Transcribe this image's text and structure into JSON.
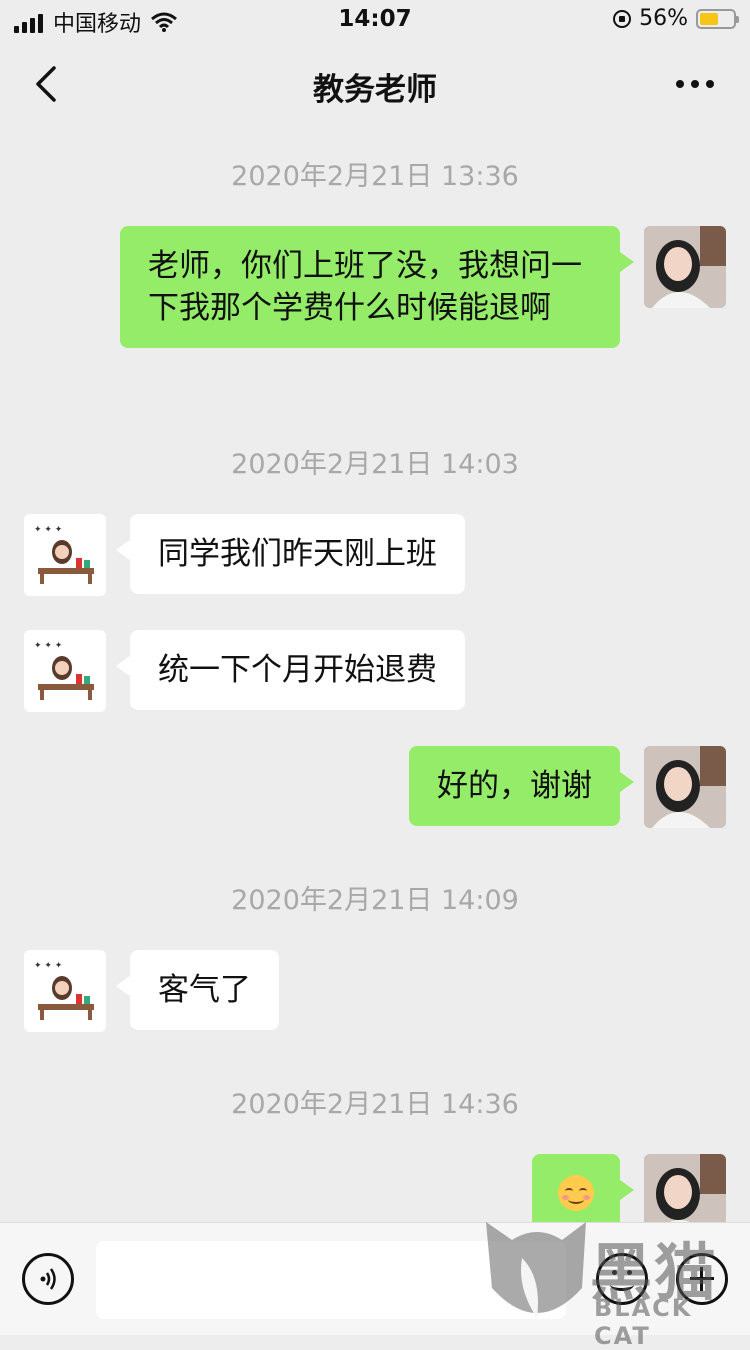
{
  "status_bar": {
    "carrier": "中国移动",
    "time": "14:07",
    "battery": "56%",
    "battery_level": 0.56
  },
  "nav": {
    "title": "教务老师"
  },
  "messages": [
    {
      "type": "timestamp",
      "text": "2020年2月21日 13:36"
    },
    {
      "type": "out",
      "text": "老师，你们上班了没，我想问一下我那个学费什么时候能退啊"
    },
    {
      "type": "timestamp",
      "text": "2020年2月21日 14:03"
    },
    {
      "type": "in",
      "text": "同学我们昨天刚上班"
    },
    {
      "type": "in",
      "text": "统一下个月开始退费"
    },
    {
      "type": "out",
      "text": "好的，谢谢"
    },
    {
      "type": "timestamp",
      "text": "2020年2月21日 14:09"
    },
    {
      "type": "in",
      "text": "客气了"
    },
    {
      "type": "timestamp",
      "text": "2020年2月21日 14:36"
    },
    {
      "type": "out",
      "icon": "smiling-face-emoji-icon"
    }
  ],
  "input_bar": {
    "icons": [
      "voice-icon",
      "emoji-icon",
      "plus-icon"
    ]
  },
  "watermark": {
    "cjk": "黑猫",
    "en": "BLACK CAT"
  },
  "colors": {
    "background": "#ededed",
    "outgoing_bubble": "#95ec69",
    "incoming_bubble": "#ffffff",
    "timestamp": "#a8a8a8",
    "battery_fill": "#f5c518"
  }
}
